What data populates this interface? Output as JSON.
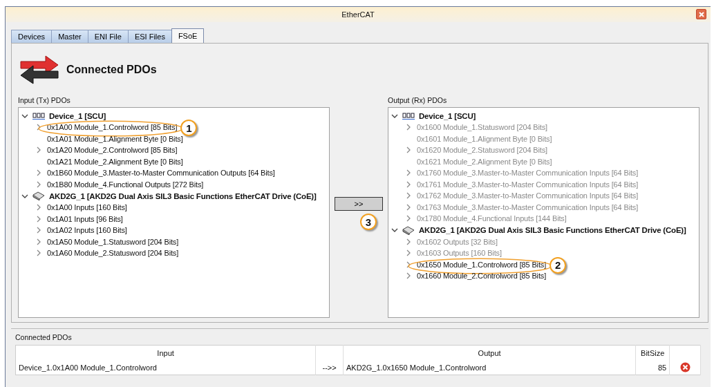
{
  "window": {
    "title": "EtherCAT"
  },
  "tabs": [
    {
      "label": "Devices",
      "selected": false
    },
    {
      "label": "Master",
      "selected": false
    },
    {
      "label": "ENI File",
      "selected": false
    },
    {
      "label": "ESI Files",
      "selected": false
    },
    {
      "label": "FSoE",
      "selected": true
    }
  ],
  "header": {
    "title": "Connected PDOs"
  },
  "input_panel": {
    "label": "Input (Tx) PDOs",
    "groups": [
      {
        "name": "Device_1 [SCU]",
        "kind": "controller",
        "expanded": true,
        "children": [
          {
            "label": "0x1A00 Module_1.Controlword [85 Bits]",
            "expandable": true,
            "dimmed": false,
            "callout": "1"
          },
          {
            "label": "0x1A01 Module_1.Alignment Byte [0 Bits]",
            "expandable": false,
            "dimmed": false
          },
          {
            "label": "0x1A20 Module_2.Controlword [85 Bits]",
            "expandable": true,
            "dimmed": false
          },
          {
            "label": "0x1A21 Module_2.Alignment Byte [0 Bits]",
            "expandable": false,
            "dimmed": false
          },
          {
            "label": "0x1B60 Module_3.Master-to-Master Communication Outputs [64 Bits]",
            "expandable": true,
            "dimmed": false
          },
          {
            "label": "0x1B80 Module_4.Functional Outputs [272 Bits]",
            "expandable": true,
            "dimmed": false
          }
        ]
      },
      {
        "name": "AKD2G_1 [AKD2G Dual Axis SIL3 Basic Functions EtherCAT Drive (CoE)]",
        "kind": "drive",
        "expanded": true,
        "children": [
          {
            "label": "0x1A00 Inputs [160 Bits]",
            "expandable": true,
            "dimmed": false
          },
          {
            "label": "0x1A01 Inputs [96 Bits]",
            "expandable": true,
            "dimmed": false
          },
          {
            "label": "0x1A02 Inputs [160 Bits]",
            "expandable": true,
            "dimmed": false
          },
          {
            "label": "0x1A50 Module_1.Statusword [204 Bits]",
            "expandable": true,
            "dimmed": false
          },
          {
            "label": "0x1A60 Module_2.Statusword [204 Bits]",
            "expandable": true,
            "dimmed": false
          }
        ]
      }
    ]
  },
  "transfer_button": {
    "label": ">>",
    "callout": "3"
  },
  "output_panel": {
    "label": "Output (Rx) PDOs",
    "groups": [
      {
        "name": "Device_1 [SCU]",
        "kind": "controller",
        "expanded": true,
        "children": [
          {
            "label": "0x1600 Module_1.Statusword [204 Bits]",
            "expandable": true,
            "dimmed": true
          },
          {
            "label": "0x1601 Module_1.Alignment Byte [0 Bits]",
            "expandable": false,
            "dimmed": true
          },
          {
            "label": "0x1620 Module_2.Statusword [204 Bits]",
            "expandable": true,
            "dimmed": true
          },
          {
            "label": "0x1621 Module_2.Alignment Byte [0 Bits]",
            "expandable": false,
            "dimmed": true
          },
          {
            "label": "0x1760 Module_3.Master-to-Master Communication Inputs [64 Bits]",
            "expandable": true,
            "dimmed": true
          },
          {
            "label": "0x1761 Module_3.Master-to-Master Communication Inputs [64 Bits]",
            "expandable": true,
            "dimmed": true
          },
          {
            "label": "0x1762 Module_3.Master-to-Master Communication Inputs [64 Bits]",
            "expandable": true,
            "dimmed": true
          },
          {
            "label": "0x1763 Module_3.Master-to-Master Communication Inputs [64 Bits]",
            "expandable": true,
            "dimmed": true
          },
          {
            "label": "0x1780 Module_4.Functional Inputs [144 Bits]",
            "expandable": true,
            "dimmed": true
          }
        ]
      },
      {
        "name": "AKD2G_1 [AKD2G Dual Axis SIL3 Basic Functions EtherCAT Drive (CoE)]",
        "kind": "drive",
        "expanded": true,
        "children": [
          {
            "label": "0x1602 Outputs [32 Bits]",
            "expandable": true,
            "dimmed": true
          },
          {
            "label": "0x1603 Outputs [160 Bits]",
            "expandable": true,
            "dimmed": true
          },
          {
            "label": "0x1650 Module_1.Controlword [85 Bits]",
            "expandable": true,
            "dimmed": false,
            "callout": "2"
          },
          {
            "label": "0x1660 Module_2.Controlword [85 Bits]",
            "expandable": true,
            "dimmed": false
          }
        ]
      }
    ]
  },
  "connections": {
    "label": "Connected PDOs",
    "columns": [
      "Input",
      "",
      "Output",
      "BitSize"
    ],
    "rows": [
      {
        "input": "Device_1.0x1A00 Module_1.Controlword",
        "arrow": "-->>",
        "output": "AKD2G_1.0x1650 Module_1.Controlword",
        "bitsize": "85"
      }
    ]
  }
}
